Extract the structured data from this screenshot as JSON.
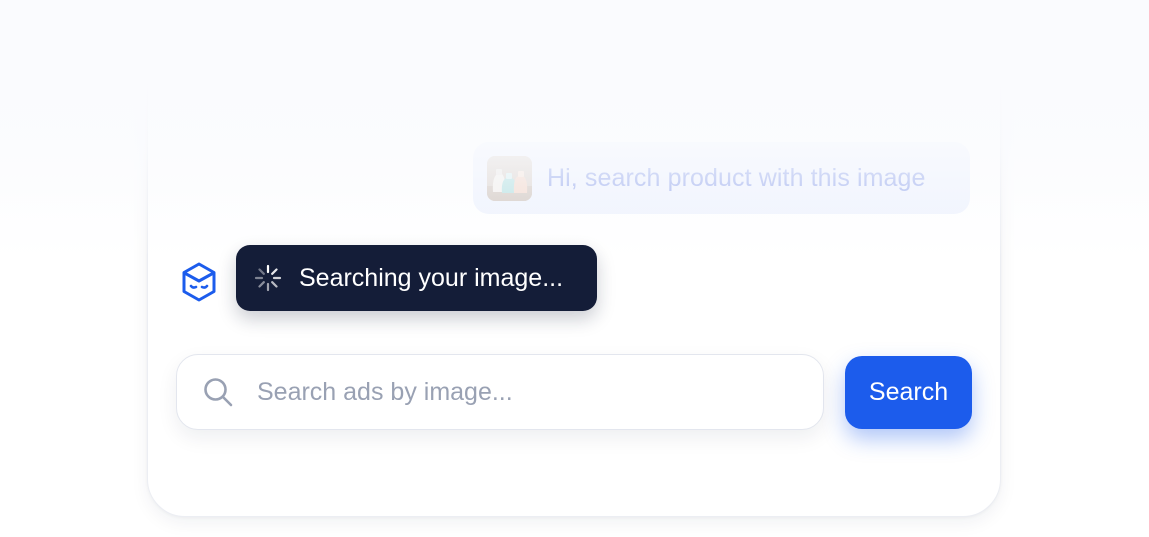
{
  "chat": {
    "user_message": "Hi, search product with this image",
    "status_text": "Searching your image..."
  },
  "search": {
    "placeholder": "Search ads by image...",
    "value": "",
    "button_label": "Search"
  },
  "icons": {
    "avatar": "bot-cube-icon",
    "spinner": "loading-spinner-icon",
    "search": "search-icon",
    "attachment": "product-image-thumbnail"
  },
  "colors": {
    "accent": "#1c5cec",
    "status_bg": "#141d38",
    "user_bubble": "#edf2fd",
    "user_text": "#8da1ea",
    "placeholder": "#99a1b3"
  }
}
